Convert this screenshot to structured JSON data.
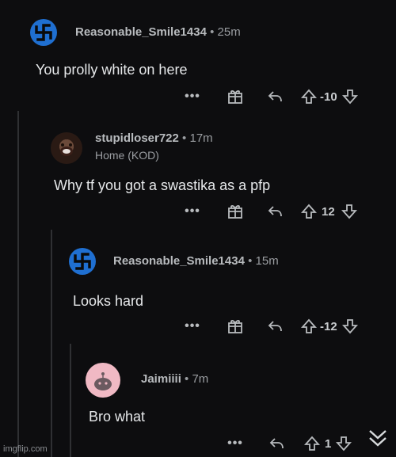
{
  "comments": [
    {
      "author": "Reasonable_Smile1434",
      "age": "25m",
      "body": "You prolly white on here",
      "score": "-10",
      "avatar_icon": "swastika-avatar"
    },
    {
      "author": "stupidloser722",
      "age": "17m",
      "flair": "Home (KOD)",
      "body": "Why tf you got a swastika as a pfp",
      "score": "12",
      "avatar_icon": "photo-avatar"
    },
    {
      "author": "Reasonable_Smile1434",
      "age": "15m",
      "body": "Looks hard",
      "score": "-12",
      "avatar_icon": "swastika-avatar"
    },
    {
      "author": "Jaimiiii",
      "age": "7m",
      "body": "Bro what",
      "score": "1",
      "avatar_icon": "snoo-avatar"
    }
  ],
  "ui": {
    "separator": "•",
    "more_label": "•••"
  },
  "watermark": "imgflip.com",
  "colors": {
    "background": "#0d0d0f",
    "thread_line": "#2f3033",
    "avatar_blue": "#1f6fd1",
    "avatar_pink": "#f0b9c4"
  }
}
